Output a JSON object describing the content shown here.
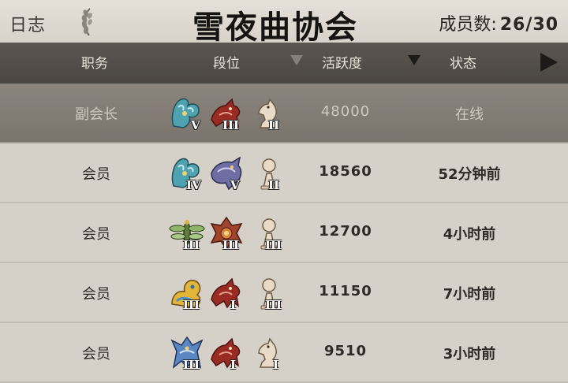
{
  "topbar": {
    "log_label": "日志",
    "title": "雪夜曲协会",
    "members_label": "成员数:",
    "members_count": "26/30"
  },
  "header": {
    "role": "职务",
    "rank": "段位",
    "activity": "活跃度",
    "status": "状态"
  },
  "rows": [
    {
      "role": "副会长",
      "activity": "48000",
      "status": "在线",
      "selected": true,
      "badges": [
        {
          "icon": "teal-beast-icon",
          "tier": "V"
        },
        {
          "icon": "red-beast-icon",
          "tier": "III"
        },
        {
          "icon": "horse-piece-icon",
          "tier": "II"
        }
      ]
    },
    {
      "role": "会员",
      "activity": "18560",
      "status": "52分钟前",
      "badges": [
        {
          "icon": "teal-beast-icon",
          "tier": "IV"
        },
        {
          "icon": "purple-dragon-icon",
          "tier": "V"
        },
        {
          "icon": "pawn-piece-icon",
          "tier": "II"
        }
      ]
    },
    {
      "role": "会员",
      "activity": "12700",
      "status": "4小时前",
      "badges": [
        {
          "icon": "green-dragonfly-icon",
          "tier": "III"
        },
        {
          "icon": "red-dragon-icon",
          "tier": "III"
        },
        {
          "icon": "pawn-piece-icon",
          "tier": "III"
        }
      ]
    },
    {
      "role": "会员",
      "activity": "11150",
      "status": "7小时前",
      "badges": [
        {
          "icon": "gold-beast-icon",
          "tier": "III"
        },
        {
          "icon": "red-beast-icon",
          "tier": "I"
        },
        {
          "icon": "pawn-piece-icon",
          "tier": "III"
        }
      ]
    },
    {
      "role": "会员",
      "activity": "9510",
      "status": "3小时前",
      "badges": [
        {
          "icon": "blue-dragon-icon",
          "tier": "III"
        },
        {
          "icon": "red-beast-icon",
          "tier": "I"
        },
        {
          "icon": "horse-piece-icon",
          "tier": "I"
        }
      ]
    }
  ],
  "colors": {
    "header_bg": "#4f4a45",
    "row_bg": "#d6d1c8",
    "selected_row_bg": "#837d76",
    "teal": "#4fa3b0",
    "red": "#9a2b22",
    "ivory": "#e8dcc8"
  }
}
